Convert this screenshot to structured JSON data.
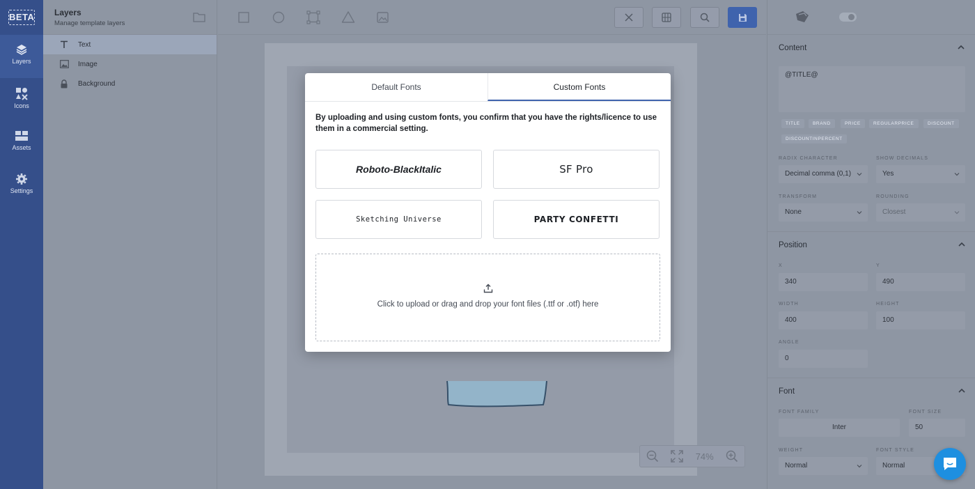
{
  "rail": {
    "beta": "BETA",
    "items": [
      {
        "label": "Layers",
        "icon": "layers-icon"
      },
      {
        "label": "Icons",
        "icon": "shapes-icon"
      },
      {
        "label": "Assets",
        "icon": "assets-icon"
      },
      {
        "label": "Settings",
        "icon": "gear-icon"
      }
    ]
  },
  "layers": {
    "title": "Layers",
    "subtitle": "Manage template layers",
    "items": [
      {
        "label": "Text",
        "icon": "text-icon",
        "selected": true
      },
      {
        "label": "Image",
        "icon": "image-icon",
        "selected": false
      },
      {
        "label": "Background",
        "icon": "lock-icon",
        "selected": false
      }
    ]
  },
  "toolbar": {
    "tools": [
      "rectangle-tool",
      "circle-tool",
      "frame-tool",
      "triangle-tool",
      "image-tool"
    ],
    "buttons": [
      "close-icon",
      "grid-icon",
      "search-icon",
      "save-icon"
    ]
  },
  "zoom": {
    "value": "74%"
  },
  "modal": {
    "tabs": {
      "default": "Default Fonts",
      "custom": "Custom Fonts"
    },
    "notice": "By uploading and using custom fonts, you confirm that you have the rights/licence to use them in a commercial setting.",
    "fonts": [
      "Roboto-BlackItalic",
      "SF Pro",
      "Sketching Universe",
      "PARTY CONFETTI"
    ],
    "upload_text": "Click to upload or drag and drop your font files (.ttf or .otf) here"
  },
  "props": {
    "content": {
      "title": "Content",
      "text_value": "@TITLE@",
      "tags": [
        "TITLE",
        "BRAND",
        "PRICE",
        "REGULARPRICE",
        "DISCOUNT",
        "DISCOUNTINPERCENT"
      ],
      "radix_label": "RADIX CHARACTER",
      "radix_value": "Decimal comma (0,1)",
      "decimals_label": "SHOW DECIMALS",
      "decimals_value": "Yes",
      "transform_label": "TRANSFORM",
      "transform_value": "None",
      "rounding_label": "ROUNDING",
      "rounding_value": "Closest"
    },
    "position": {
      "title": "Position",
      "x_label": "X",
      "x_value": "340",
      "y_label": "Y",
      "y_value": "490",
      "width_label": "WIDTH",
      "width_value": "400",
      "height_label": "HEIGHT",
      "height_value": "100",
      "angle_label": "ANGLE",
      "angle_value": "0"
    },
    "font": {
      "title": "Font",
      "family_label": "FONT FAMILY",
      "family_value": "Inter",
      "size_label": "FONT SIZE",
      "size_value": "50",
      "weight_label": "WEIGHT",
      "weight_value": "Normal",
      "style_label": "FONT STYLE",
      "style_value": "Normal"
    }
  },
  "colors": {
    "rail": "#354f8a",
    "accent": "#3f63ad",
    "chat": "#1e8fe0"
  }
}
